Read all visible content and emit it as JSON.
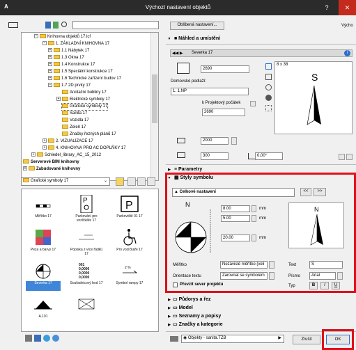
{
  "window": {
    "title": "Výchozí nastavení objektů",
    "help": "?",
    "close": "✕"
  },
  "left": {
    "search_placeholder": "",
    "tree": [
      {
        "label": "Knihovna objektů 17.lcf",
        "pm": "−"
      },
      {
        "label": "1. ZÁKLADNÍ KNIHOVNA 17",
        "pm": "−"
      },
      {
        "label": "1.1 Nábytek 17",
        "pm": "+"
      },
      {
        "label": "1.3 Okna 17",
        "pm": "+"
      },
      {
        "label": "1.4 Konstrukce 17",
        "pm": "+"
      },
      {
        "label": "1.5 Speciální konstrukce 17",
        "pm": "+"
      },
      {
        "label": "1.6 Technické zařízení budov 17",
        "pm": "+"
      },
      {
        "label": "1.7 2D prvky 17",
        "pm": "−"
      },
      {
        "label": "Anotační bubliny 17",
        "pm": ""
      },
      {
        "label": "Elektrické symboly 17",
        "pm": "+"
      },
      {
        "label": "Grafické symboly 17",
        "pm": ""
      },
      {
        "label": "Sanita 17",
        "pm": ""
      },
      {
        "label": "Vozidla 17",
        "pm": ""
      },
      {
        "label": "Zeleň 17",
        "pm": ""
      },
      {
        "label": "Značky řezných plánů 17",
        "pm": ""
      },
      {
        "label": "2. VIZUALIZACE 17",
        "pm": "+"
      },
      {
        "label": "4. KNIHOVNA PRO AC DOPLŇKY 17",
        "pm": "+"
      },
      {
        "label": "Schiedel_library_AC_15_2012",
        "pm": "+"
      },
      {
        "label": "Serverové BIM knihovny",
        "pm": ""
      },
      {
        "label": "Zabudované knihovny",
        "pm": "+"
      }
    ],
    "folder_select": "Grafické symboly 17",
    "tiles": [
      {
        "label": "Měřítko 17",
        "sel": false,
        "icon": "scale-bar"
      },
      {
        "label": "Parkování pro vozíčkáře 17",
        "sel": false,
        "icon": "parking-wheelchair"
      },
      {
        "label": "Parkoviště 01 17",
        "sel": false,
        "icon": "parking"
      },
      {
        "label": "Peza a barvy 17",
        "sel": false,
        "icon": "pens-colors"
      },
      {
        "label": "Popiska z více řádků 17",
        "sel": false,
        "icon": "multiline-label"
      },
      {
        "label": "Pro vozíčkáře 17",
        "sel": false,
        "icon": "wheelchair"
      },
      {
        "label": "Severka 17",
        "sel": true,
        "icon": "north-arrow"
      },
      {
        "label": "Souřadnicový bod 17",
        "sel": false,
        "icon": "coordinate-point"
      },
      {
        "label": "Symbol rampy 17",
        "sel": false,
        "icon": "ramp"
      },
      {
        "label": "A.101",
        "sel": false,
        "icon": "section-mark"
      },
      {
        "label": "",
        "sel": false,
        "icon": "crossed-box"
      },
      {
        "label": "",
        "sel": false,
        "icon": "empty"
      }
    ],
    "coord_values": [
      "001",
      "0,0000",
      "0,0000",
      "0,0000"
    ],
    "ramp_value": "2 %"
  },
  "right": {
    "favorites": "Oblíbená nastavení...",
    "vychozi": "Výcho",
    "section_preview": "Náhled a umístění",
    "object_name": "Severka 17",
    "height1": "2690",
    "home_floor_label": "Domovské podlaží:",
    "home_floor": "1. 1.NP",
    "proj_label": "k Projektový počátek",
    "height2": "2690",
    "dim_a": "2000",
    "dim_b": "300",
    "angle": "0,00°",
    "preview_label": "S",
    "sizes": "8 x 38",
    "section_params": "Parametry",
    "section_styles": "Styly symbolu",
    "general_settings": "Celkové nastavení",
    "nav_prev": "<<",
    "nav_next": ">>",
    "sym_north": "N",
    "v1": "8.00",
    "v2": "5.00",
    "v3": "20.00",
    "unit": "mm",
    "big_north": "N",
    "scale_label": "Měřítko",
    "scale_value": "Nezávislé měřítko (veli",
    "text_label": "Text",
    "text_value": "S",
    "orient_label": "Orientace textu",
    "orient_value": "Zarovnat se symbolem",
    "font_label": "Písmo",
    "font_value": "Arial",
    "type_label": "Typ",
    "type_b": "B",
    "type_i": "I",
    "type_u": "U",
    "checkbox_label": "Převzít sever projektu",
    "sections": [
      "Půdorys a řez",
      "Model",
      "Seznamy a popisy",
      "Značky a kategorie"
    ],
    "layer": "Objekty - sanita.TZB",
    "cancel": "Zrušit",
    "ok": "OK"
  }
}
